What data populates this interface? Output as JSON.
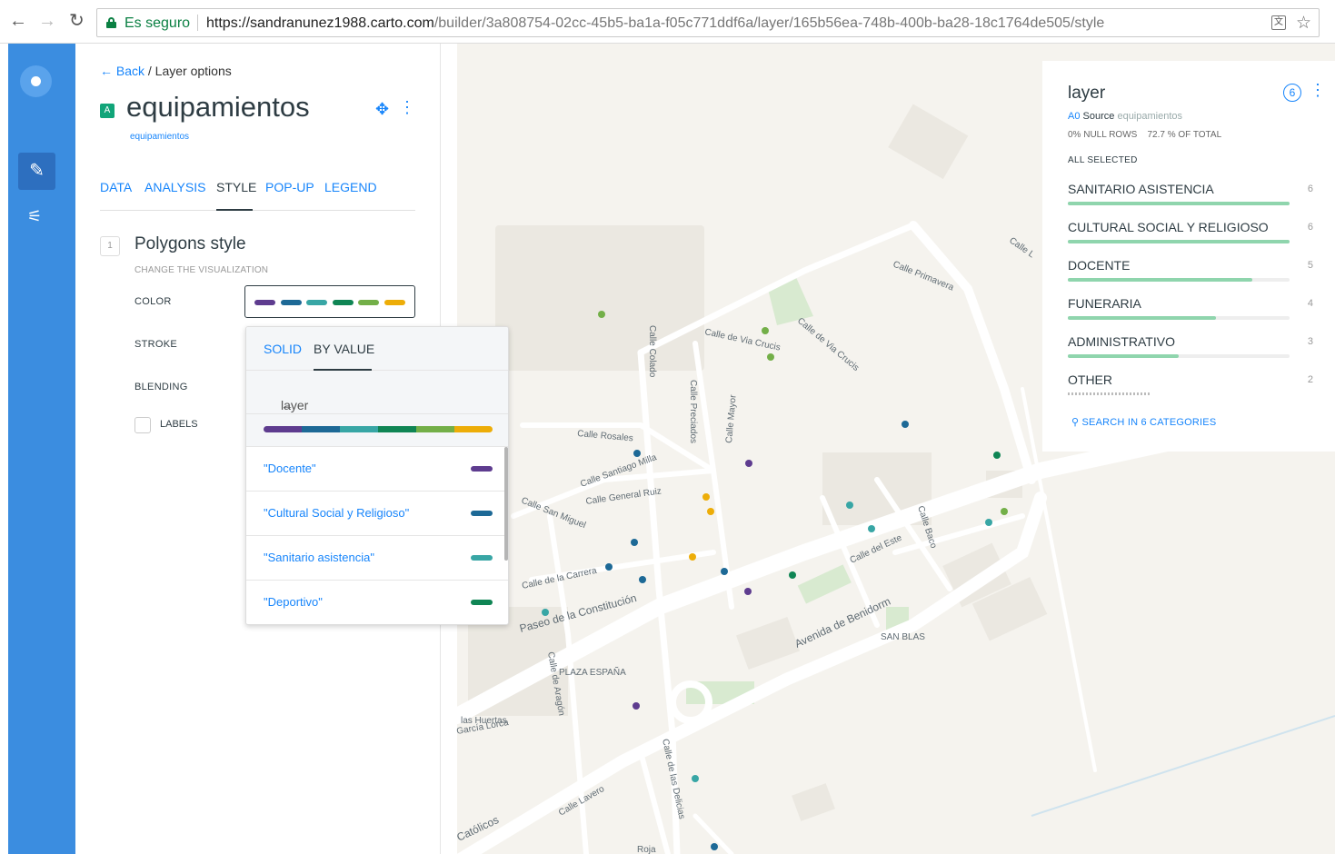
{
  "browser": {
    "secure_text": "Es seguro",
    "url_host": "https://sandranunez1988.carto.com",
    "url_path": "/builder/3a808754-02cc-45b5-ba1a-f05c771ddf6a/layer/165b56ea-748b-400b-ba28-18c1764de505/style"
  },
  "panel": {
    "back_label": "Back",
    "breadcrumb_rest": " / Layer options",
    "layer_letter": "A",
    "layer_name": "equipamientos",
    "layer_source": "equipamientos",
    "tabs": [
      "DATA",
      "ANALYSIS",
      "STYLE",
      "POP-UP",
      "LEGEND"
    ],
    "active_tab": "STYLE",
    "section_number": "1",
    "section_title": "Polygons style",
    "section_subtitle": "CHANGE THE VISUALIZATION",
    "props": {
      "color": "COLOR",
      "stroke": "STROKE",
      "blending": "BLENDING",
      "labels": "LABELS"
    },
    "ramp_colors": [
      "#5e3c8f",
      "#1d6996",
      "#38a6a5",
      "#0f8554",
      "#73af48",
      "#edad08"
    ]
  },
  "dropdown": {
    "tab_solid": "SOLID",
    "tab_byvalue": "BY VALUE",
    "back_label": "layer",
    "items": [
      {
        "name": "\"Docente\"",
        "color": "#5e3c8f"
      },
      {
        "name": "\"Cultural Social y Religioso\"",
        "color": "#1d6996"
      },
      {
        "name": "\"Sanitario asistencia\"",
        "color": "#38a6a5"
      },
      {
        "name": "\"Deportivo\"",
        "color": "#0f8554"
      }
    ]
  },
  "map": {
    "streets": [
      "Calle Primavera",
      "Calle de Via Crucis",
      "Calle de Via Crucis",
      "Calle Colado",
      "Calle Preciados",
      "Calle Mayor",
      "Calle Rosales",
      "Calle Santiago Milla",
      "Calle General Ruiz",
      "Calle San Miguel",
      "Calle de la Carrera",
      "Paseo de la Constitución",
      "Avenida de Benidorm",
      "Calle del Este",
      "Calle Baco",
      "SAN BLAS",
      "PLAZA ESPAÑA",
      "Calle de Aragón",
      "las Huertas",
      "García Lorca",
      "Calle de las Delicias",
      "Calle Lavero",
      "Católicos",
      "Roja",
      "Calle L"
    ]
  },
  "widget": {
    "title": "layer",
    "source_code": "A0",
    "source_word": "Source",
    "source_name": "equipamientos",
    "null_rows": "0% NULL ROWS",
    "of_total": "72.7 % OF TOTAL",
    "all_selected": "ALL SELECTED",
    "categories": [
      {
        "label": "SANITARIO ASISTENCIA",
        "count": "6",
        "fill": 1.0
      },
      {
        "label": "CULTURAL SOCIAL Y RELIGIOSO",
        "count": "6",
        "fill": 1.0
      },
      {
        "label": "DOCENTE",
        "count": "5",
        "fill": 0.83
      },
      {
        "label": "FUNERARIA",
        "count": "4",
        "fill": 0.67
      },
      {
        "label": "ADMINISTRATIVO",
        "count": "3",
        "fill": 0.5
      },
      {
        "label": "OTHER",
        "count": "2",
        "fill": 0.0
      }
    ],
    "search_label": "SEARCH IN 6 CATEGORIES"
  }
}
